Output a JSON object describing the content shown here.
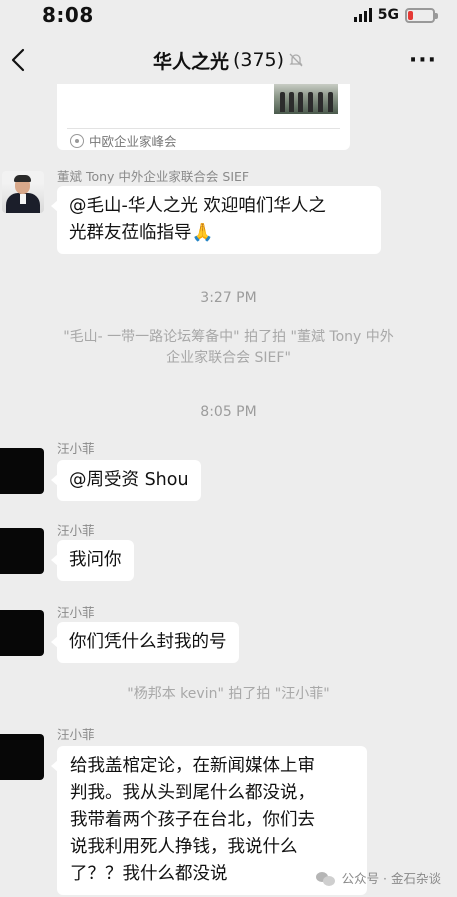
{
  "status": {
    "time": "8:08",
    "network": "5G"
  },
  "nav": {
    "title": "华人之光",
    "count": "(375)",
    "mute_icon": "bell-muted-icon",
    "more": "···"
  },
  "shared_card": {
    "source": "中欧企业家峰会"
  },
  "messages": [
    {
      "sender": "董斌 Tony 中外企业家联合会 SIEF",
      "lines": [
        "@毛山-华人之光 欢迎咱们华人之",
        "光群友莅临指导🙏"
      ]
    },
    {
      "sender": "汪小菲",
      "lines": [
        "@周受资 Shou"
      ]
    },
    {
      "sender": "汪小菲",
      "lines": [
        "我问你"
      ]
    },
    {
      "sender": "汪小菲",
      "lines": [
        "你们凭什么封我的号"
      ]
    },
    {
      "sender": "汪小菲",
      "lines": [
        "给我盖棺定论，在新闻媒体上审",
        "判我。我从头到尾什么都没说，",
        "我带着两个孩子在台北，你们去",
        "说我利用死人挣钱，我说什么",
        "了？？我什么都没说"
      ]
    }
  ],
  "timestamps": [
    "3:27 PM",
    "8:05 PM"
  ],
  "system_notes": [
    [
      "\"毛山- 一带一路论坛筹备中\" 拍了拍 \"董斌 Tony 中外",
      "企业家联合会 SIEF\""
    ],
    [
      "\"杨邦本 kevin\" 拍了拍 \"汪小菲\""
    ]
  ],
  "watermark": {
    "text": "公众号 · 金石杂谈",
    "icon": "wechat-official-account-icon"
  },
  "colors": {
    "background": "#ededed",
    "bubble": "#ffffff",
    "battery_low": "#e53935"
  }
}
